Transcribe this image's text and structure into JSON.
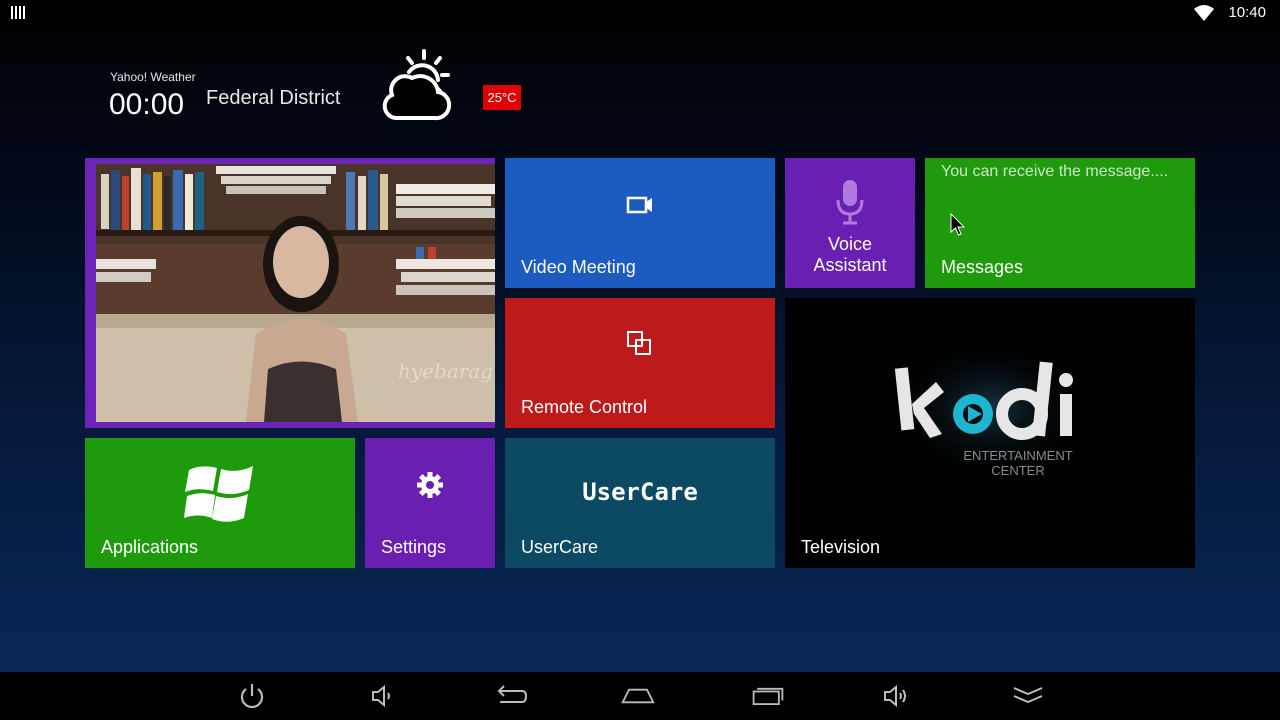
{
  "status_bar": {
    "time": "10:40"
  },
  "weather": {
    "source": "Yahoo! Weather",
    "time": "00:00",
    "location": "Federal District",
    "temperature": "25°C",
    "condition_icon": "partly-cloudy-icon"
  },
  "tiles": {
    "video_meeting": {
      "label": "Video Meeting",
      "color": "#1c5cc0"
    },
    "voice_assistant": {
      "label": "Voice Assistant",
      "line1": "Voice",
      "line2": "Assistant",
      "color": "#6a1fb3"
    },
    "messages": {
      "label": "Messages",
      "preview": "You can receive the message....",
      "color": "#1e9a0c"
    },
    "remote_control": {
      "label": "Remote Control",
      "color": "#bd1b1b"
    },
    "television": {
      "label": "Television",
      "logo_subtitle_1": "ENTERTAINMENT",
      "logo_subtitle_2": "CENTER"
    },
    "applications": {
      "label": "Applications",
      "color": "#1e9a0c"
    },
    "settings": {
      "label": "Settings",
      "color": "#6a1fb3"
    },
    "usercare": {
      "label": "UserCare",
      "logo": "UserCare",
      "color": "#0b4a62"
    }
  },
  "nav_bar": {
    "buttons": [
      "power-icon",
      "volume-down-icon",
      "back-icon",
      "home-icon",
      "recent-apps-icon",
      "volume-up-icon",
      "collapse-icon"
    ]
  }
}
